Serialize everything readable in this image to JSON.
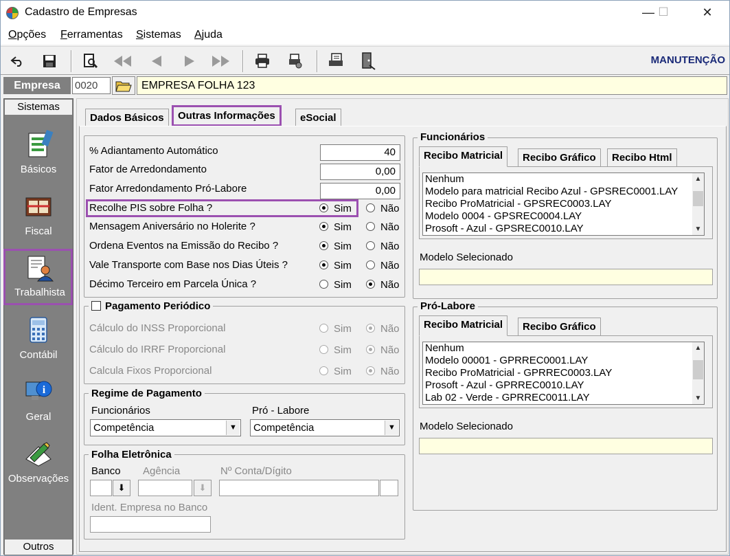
{
  "window": {
    "title": "Cadastro de Empresas",
    "minimize": "—",
    "maximize": "☐",
    "close": "✕"
  },
  "menu": [
    {
      "first": "O",
      "rest": "pções"
    },
    {
      "first": "F",
      "rest": "erramentas"
    },
    {
      "first": "S",
      "rest": "istemas"
    },
    {
      "first": "A",
      "rest": "juda"
    }
  ],
  "toolbar": {
    "mode": "MANUTENÇÃO",
    "icons": [
      "undo-icon",
      "save-icon",
      "preview-icon",
      "first-icon",
      "prev-icon",
      "next-icon",
      "last-icon",
      "print-icon",
      "print-setup-icon",
      "report-icon",
      "exit-icon"
    ]
  },
  "empresa": {
    "label": "Empresa",
    "code": "0020",
    "name": "EMPRESA FOLHA 123"
  },
  "sidebar": {
    "top": "Sistemas",
    "bottom": "Outros",
    "items": [
      "Básicos",
      "Fiscal",
      "Trabalhista",
      "Contábil",
      "Geral",
      "Observações"
    ],
    "selected": "Trabalhista"
  },
  "tabs": [
    "Dados Básicos",
    "Outras Informações",
    "eSocial"
  ],
  "activeTab": "Outras Informações",
  "left": {
    "adiantamento": {
      "label": "% Adiantamento Automático",
      "value": "40"
    },
    "arredondamento": {
      "label": "Fator de Arredondamento",
      "value": "0,00"
    },
    "arredProLabore": {
      "label": "Fator Arredondamento Pró-Labore",
      "value": "0,00"
    },
    "options": [
      {
        "label": "Recolhe PIS sobre Folha ?",
        "sim": true
      },
      {
        "label": "Mensagem Aniversário no Holerite ?",
        "sim": true
      },
      {
        "label": "Ordena Eventos na Emissão do Recibo ?",
        "sim": true
      },
      {
        "label": "Vale Transporte com Base nos Dias Úteis ?",
        "sim": true
      },
      {
        "label": "Décimo Terceiro em Parcela Única ?",
        "sim": false
      }
    ],
    "sim": "Sim",
    "nao": "Não",
    "pagamento": {
      "title": "Pagamento Periódico",
      "checked": false,
      "items": [
        "Cálculo do INSS Proporcional",
        "Cálculo do IRRF Proporcional",
        "Calcula Fixos Proporcional"
      ]
    },
    "regime": {
      "title": "Regime de Pagamento",
      "funcLabel": "Funcionários",
      "funcValue": "Competência",
      "proLabel": "Pró - Labore",
      "proValue": "Competência"
    },
    "folha": {
      "title": "Folha Eletrônica",
      "banco": "Banco",
      "agencia": "Agência",
      "conta": "Nº Conta/Dígito",
      "ident": "Ident. Empresa no Banco"
    }
  },
  "right": {
    "func": {
      "title": "Funcionários",
      "tabs": [
        "Recibo Matricial",
        "Recibo Gráfico",
        "Recibo Html"
      ],
      "items": [
        "Nenhum",
        "Modelo para matricial Recibo Azul - GPSREC0001.LAY",
        "Recibo ProMatricial - GPSREC0003.LAY",
        "Modelo 0004 - GPSREC0004.LAY",
        "Prosoft - Azul - GPSREC0010.LAY"
      ],
      "modeloLabel": "Modelo Selecionado"
    },
    "pro": {
      "title": "Pró-Labore",
      "tabs": [
        "Recibo Matricial",
        "Recibo Gráfico"
      ],
      "items": [
        "Nenhum",
        "Modelo 00001 - GPRREC0001.LAY",
        "Recibo ProMatricial - GPRREC0003.LAY",
        "Prosoft - Azul - GPRREC0010.LAY",
        "Lab 02 - Verde - GPRREC0011.LAY"
      ],
      "modeloLabel": "Modelo Selecionado"
    }
  }
}
